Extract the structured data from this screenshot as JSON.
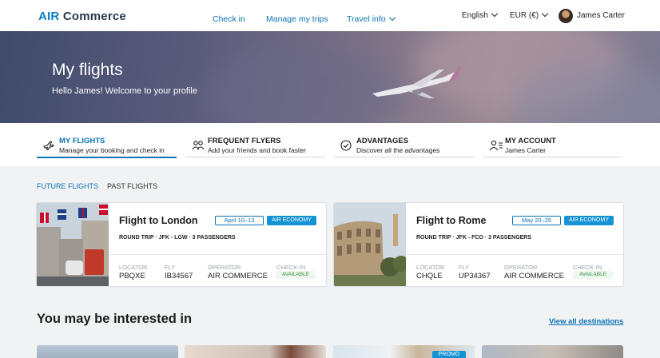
{
  "header": {
    "logo_a": "AIR",
    "logo_b": "Commerce",
    "nav": [
      "Check in",
      "Manage my trips",
      "Travel info"
    ],
    "language": "English",
    "currency": "EUR (€)",
    "user_name": "James Carter"
  },
  "hero": {
    "title": "My flights",
    "subtitle": "Hello James! Welcome to your profile"
  },
  "tabs": [
    {
      "title": "MY FLIGHTS",
      "subtitle": "Manage your booking and check in",
      "icon": "plane-icon",
      "active": true
    },
    {
      "title": "FREQUENT FLYERS",
      "subtitle": "Add your friends and book faster",
      "icon": "users-icon",
      "active": false
    },
    {
      "title": "ADVANTAGES",
      "subtitle": "Discover all the advantages",
      "icon": "check-circle-icon",
      "active": false
    },
    {
      "title": "MY ACCOUNT",
      "subtitle": "James Carter",
      "icon": "user-icon",
      "active": false
    }
  ],
  "flight_tabs": {
    "future": "FUTURE FLIGHTS",
    "past": "PAST FLIGHTS"
  },
  "flights": [
    {
      "title": "Flight to London",
      "date": "April 10–13",
      "class": "AIR ECONOMY",
      "details": "ROUND TRIP  ·  JFK - LGW  ·  3 PASSENGERS",
      "labels": {
        "locator": "LOCATOR",
        "fly": "FLY",
        "operator": "OPERATOR",
        "checkin": "CHECK-IN"
      },
      "locator": "PBQXE",
      "fly": "IB34567",
      "operator": "AIR COMMERCE",
      "checkin_status": "AVAILABLE"
    },
    {
      "title": "Flight to Rome",
      "date": "May 20–25",
      "class": "AIR ECONOMY",
      "details": "ROUND TRIP  ·  JFK - FCO  ·  3 PASSENGERS",
      "labels": {
        "locator": "LOCATOR",
        "fly": "FLY",
        "operator": "OPERATOR",
        "checkin": "CHECK-IN"
      },
      "locator": "CHQLE",
      "fly": "UP34367",
      "operator": "AIR COMMERCE",
      "checkin_status": "AVAILABLE"
    }
  ],
  "interest": {
    "title": "You may be interested in",
    "view_all": "View all destinations",
    "promo": "PROMO"
  },
  "colors": {
    "accent": "#0b72b5",
    "badge": "#1593d4",
    "available": "#2e8b3a"
  }
}
